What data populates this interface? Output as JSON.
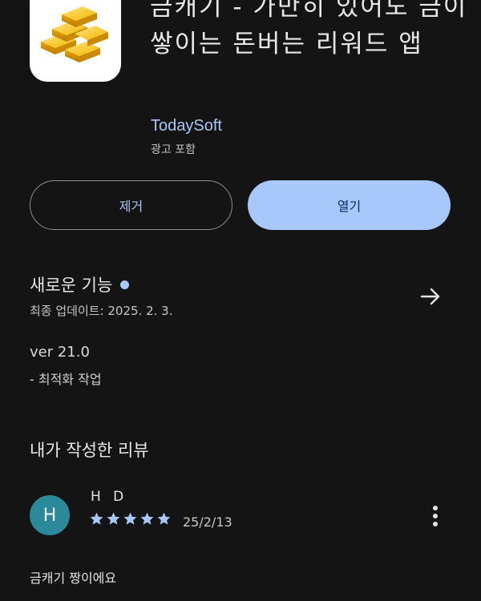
{
  "app": {
    "title": "금캐기 - 가만히 있어도 금이 쌓이는 돈버는 리워드 앱",
    "developer": "TodaySoft",
    "ads_note": "광고 포함",
    "icon": "gold-bars-icon"
  },
  "actions": {
    "remove_label": "제거",
    "open_label": "열기"
  },
  "whats_new": {
    "title": "새로운 기능",
    "updated": "최종 업데이트: 2025. 2. 3.",
    "version": "ver 21.0",
    "notes": "- 최적화 작업"
  },
  "my_review": {
    "title": "내가 작성한 리뷰",
    "avatar_letter": "H",
    "reviewer": "H D",
    "rating": 5,
    "date": "25/2/13",
    "text": "금캐기 짱이에요"
  },
  "colors": {
    "background": "#141414",
    "accent": "#a8c7fa",
    "avatar": "#2b8a9a"
  }
}
